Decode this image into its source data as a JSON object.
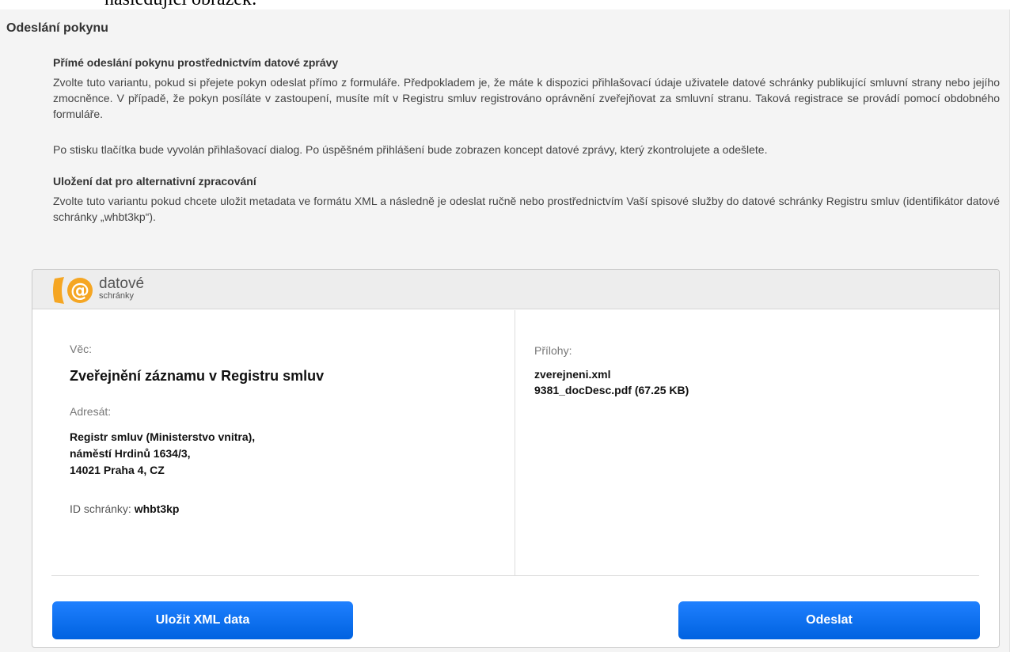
{
  "document": {
    "heading_fragment": "následující obrázek:"
  },
  "panel": {
    "title": "Odeslání pokynu"
  },
  "direct_send": {
    "heading": "Přímé odeslání pokynu prostřednictvím datové zprávy",
    "paragraph1": "Zvolte tuto variantu, pokud si přejete pokyn odeslat přímo z formuláře. Předpokladem je, že máte k dispozici přihlašovací údaje uživatele datové schránky publikující smluvní strany nebo jejího zmocněnce. V případě, že pokyn posíláte v zastoupení, musíte mít v Registru smluv registrováno oprávnění zveřejňovat za smluvní stranu. Taková registrace se provádí pomocí obdobného formuláře.",
    "paragraph2": "Po stisku tlačítka bude vyvolán přihlašovací dialog. Po úspěšném přihlášení bude zobrazen koncept datové zprávy, který zkontrolujete a odešlete."
  },
  "alt_processing": {
    "heading": "Uložení dat pro alternativní zpracování",
    "paragraph": "Zvolte tuto variantu pokud chcete uložit metadata ve formátu XML a následně je odeslat ručně nebo prostřednictvím Vaší spisové služby do datové schránky Registru smluv (identifikátor datové schránky „whbt3kp“)."
  },
  "databox": {
    "logo_word1": "datové",
    "logo_word2": "schránky",
    "subject_label": "Věc:",
    "subject": "Zveřejnění záznamu v Registru smluv",
    "recipient_label": "Adresát:",
    "recipient_lines": [
      "Registr smluv (Ministerstvo vnitra),",
      "náměstí Hrdinů 1634/3,",
      "14021 Praha 4, CZ"
    ],
    "box_id_label": "ID schránky:",
    "box_id": "whbt3kp",
    "attachments_label": "Přílohy:",
    "attachments": [
      "zverejneni.xml",
      "9381_docDesc.pdf (67.25 KB)"
    ],
    "save_button": "Uložit XML data",
    "send_button": "Odeslat"
  },
  "colors": {
    "panel_background": "#f4f4f4",
    "button_blue": "#0a6ef0",
    "logo_orange": "#f5a623"
  }
}
